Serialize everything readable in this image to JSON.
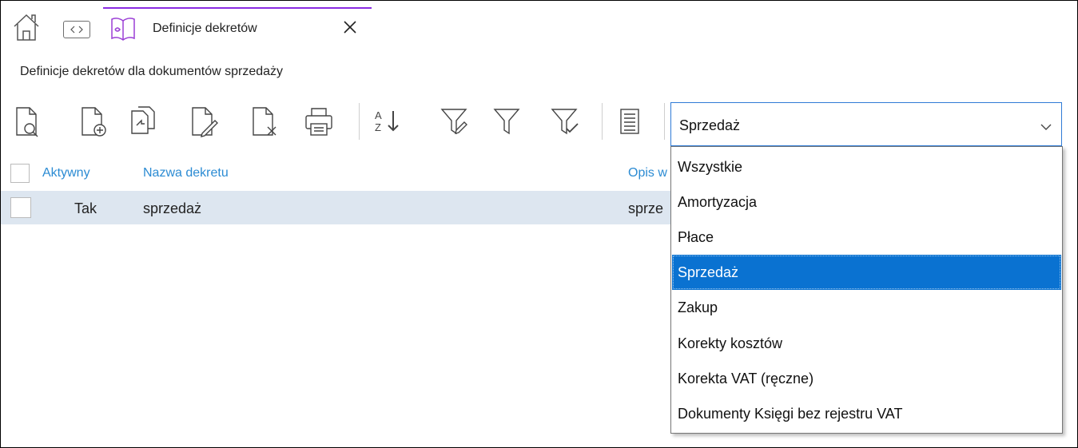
{
  "tab": {
    "title": "Definicje dekretów",
    "home_icon": "home-icon",
    "nav_icon": "nav-arrows-icon",
    "close_icon": "close-icon"
  },
  "subtitle": "Definicje dekretów dla dokumentów sprzedaży",
  "toolbar": {
    "icons": [
      "preview-document-icon",
      "add-document-icon",
      "copy-document-icon",
      "edit-document-icon",
      "delete-document-icon",
      "print-icon",
      "sort-az-icon",
      "filter-edit-icon",
      "filter-icon",
      "filter-check-icon",
      "list-icon"
    ]
  },
  "filter_combo": {
    "value": "Sprzedaż",
    "options": [
      "Wszystkie",
      "Amortyzacja",
      "Płace",
      "Sprzedaż",
      "Zakup",
      "Korekty kosztów",
      "Korekta VAT (ręczne)",
      "Dokumenty Księgi bez rejestru VAT"
    ],
    "selected": "Sprzedaż"
  },
  "table": {
    "columns": [
      "Aktywny",
      "Nazwa dekretu",
      "Opis w"
    ],
    "rows": [
      {
        "aktywny": "Tak",
        "nazwa": "sprzedaż",
        "opis": "sprze"
      }
    ]
  },
  "colors": {
    "accent": "#8a2be2",
    "header_text": "#2b8bd3",
    "row_highlight": "#dde6f0",
    "selection": "#0a72d1"
  }
}
